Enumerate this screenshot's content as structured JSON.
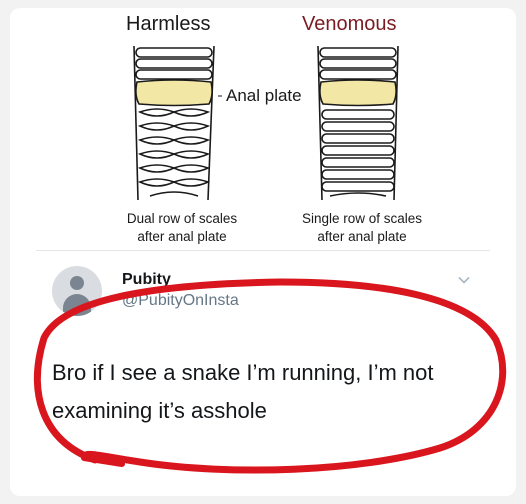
{
  "diagram": {
    "title_harmless": "Harmless",
    "title_venomous": "Venomous",
    "anal_plate_label": "Anal plate",
    "caption_harmless_line1": "Dual row of scales",
    "caption_harmless_line2": "after anal plate",
    "caption_venomous_line1": "Single row of scales",
    "caption_venomous_line2": "after anal plate"
  },
  "tweet": {
    "display_name": "Pubity",
    "handle": "@PubityOnInsta",
    "text": "Bro if I see a snake I’m running, I’m not examining it’s asshole",
    "icons": [
      "avatar-placeholder-icon",
      "chevron-down-icon"
    ]
  },
  "colors": {
    "venomous_title": "#7a1c22",
    "anal_plate_fill": "#f3e7a6",
    "annotation_circle": "#d9161d"
  }
}
